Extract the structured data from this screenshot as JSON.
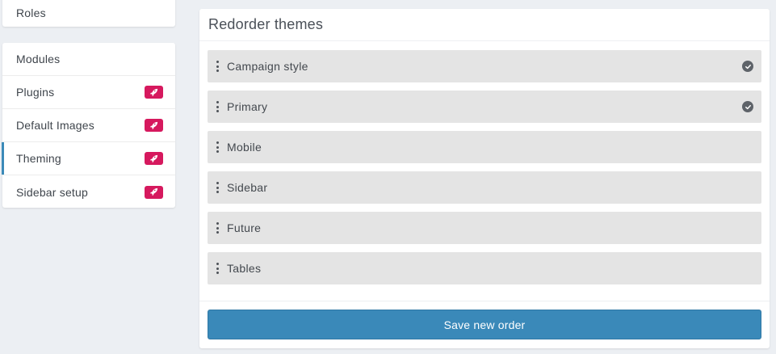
{
  "sidebar": {
    "top_item": {
      "label": "Roles"
    },
    "items": [
      {
        "label": "Modules",
        "badge": false,
        "active": false
      },
      {
        "label": "Plugins",
        "badge": true,
        "active": false
      },
      {
        "label": "Default Images",
        "badge": true,
        "active": false
      },
      {
        "label": "Theming",
        "badge": true,
        "active": true
      },
      {
        "label": "Sidebar setup",
        "badge": true,
        "active": false
      }
    ],
    "badge_icon": "rocket-icon",
    "badge_color": "#d6195e",
    "active_accent": "#3b8ab8"
  },
  "panel": {
    "title": "Redorder themes",
    "themes": [
      {
        "name": "Campaign style",
        "checked": true
      },
      {
        "name": "Primary",
        "checked": true
      },
      {
        "name": "Mobile",
        "checked": false
      },
      {
        "name": "Sidebar",
        "checked": false
      },
      {
        "name": "Future",
        "checked": false
      },
      {
        "name": "Tables",
        "checked": false
      }
    ],
    "save_label": "Save new order",
    "button_color": "#3a89b9"
  }
}
